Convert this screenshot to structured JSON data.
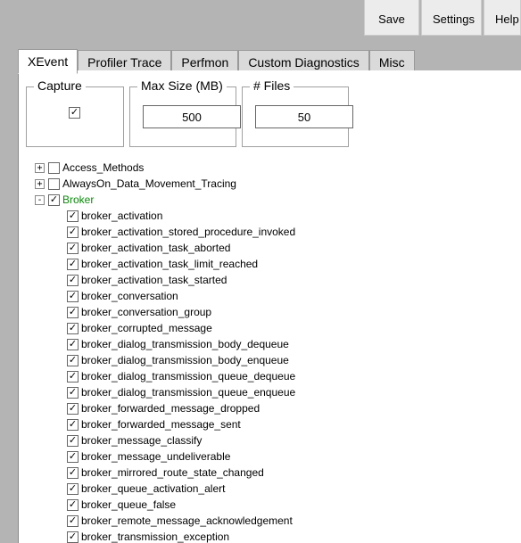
{
  "toolbar": {
    "save": "Save",
    "settings": "Settings",
    "help": "Help"
  },
  "tabs": {
    "t0": "XEvent",
    "t1": "Profiler Trace",
    "t2": "Perfmon",
    "t3": "Custom Diagnostics",
    "t4": "Misc"
  },
  "groups": {
    "capture_label": "Capture",
    "capture_checked": true,
    "size_label": "Max Size (MB)",
    "size_value": "500",
    "files_label": "# Files",
    "files_value": "50"
  },
  "tree": {
    "n0": {
      "exp": "+",
      "checked": false,
      "label": "Access_Methods"
    },
    "n1": {
      "exp": "+",
      "checked": false,
      "label": "AlwaysOn_Data_Movement_Tracing"
    },
    "n2": {
      "exp": "-",
      "checked": true,
      "label": "Broker"
    },
    "c": [
      "broker_activation",
      "broker_activation_stored_procedure_invoked",
      "broker_activation_task_aborted",
      "broker_activation_task_limit_reached",
      "broker_activation_task_started",
      "broker_conversation",
      "broker_conversation_group",
      "broker_corrupted_message",
      "broker_dialog_transmission_body_dequeue",
      "broker_dialog_transmission_body_enqueue",
      "broker_dialog_transmission_queue_dequeue",
      "broker_dialog_transmission_queue_enqueue",
      "broker_forwarded_message_dropped",
      "broker_forwarded_message_sent",
      "broker_message_classify",
      "broker_message_undeliverable",
      "broker_mirrored_route_state_changed",
      "broker_queue_activation_alert",
      "broker_queue_false",
      "broker_remote_message_acknowledgement",
      "broker_transmission_exception"
    ]
  }
}
